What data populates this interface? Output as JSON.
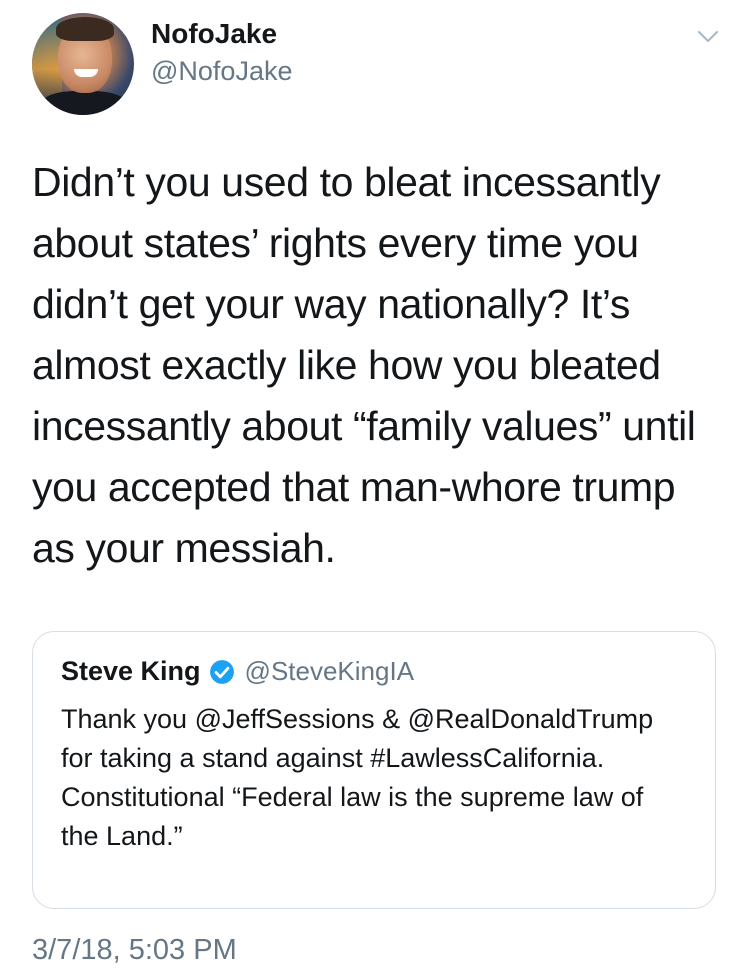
{
  "author": {
    "display_name": "NofoJake",
    "handle": "@NofoJake"
  },
  "icons": {
    "more": "chevron-down-icon",
    "verified": "verified-badge-icon"
  },
  "tweet": {
    "text": "Didn’t you used to bleat incessantly about states’ rights every time you didn’t get your way nationally? It’s almost exactly like how you bleated incessantly about “family values” until you accepted that man-whore trump as your messiah.",
    "timestamp": "3/7/18, 5:03 PM"
  },
  "quoted_tweet": {
    "display_name": "Steve King",
    "handle": "@SteveKingIA",
    "text": "Thank you @JeffSessions & @RealDonaldTrump for taking a stand against #LawlessCalifornia. Constitutional “Federal law is the supreme law of the Land.”"
  },
  "colors": {
    "text_primary": "#14171a",
    "text_secondary": "#657786",
    "border": "#d6dde3",
    "verified_blue": "#1da1f2"
  }
}
